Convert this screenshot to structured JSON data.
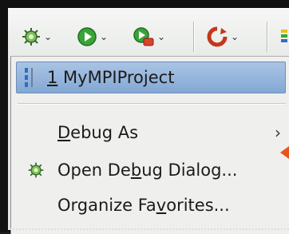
{
  "toolbar": {
    "buttons": [
      {
        "icon": "debug-gear-icon"
      },
      {
        "icon": "run-icon"
      },
      {
        "icon": "run-external-icon"
      },
      {
        "icon": "refresh-icon"
      },
      {
        "icon": "chart-icon"
      }
    ],
    "dropdown_glyph": "⌄",
    "colors": {
      "run_green": "#2f9c2f",
      "refresh_red": "#c4371c",
      "debug_green": "#3e8e3e"
    }
  },
  "menu": {
    "recent_item": {
      "mnemonic": "1",
      "label": " MyMPIProject"
    },
    "debug_as": {
      "pre": "",
      "mnemonic": "D",
      "post": "ebug As",
      "arrow": "›"
    },
    "open_dialog": {
      "pre": "Open De",
      "mnemonic": "b",
      "post": "ug Dialog..."
    },
    "organize": {
      "pre": "Organize Fa",
      "mnemonic": "v",
      "post": "orites..."
    }
  }
}
